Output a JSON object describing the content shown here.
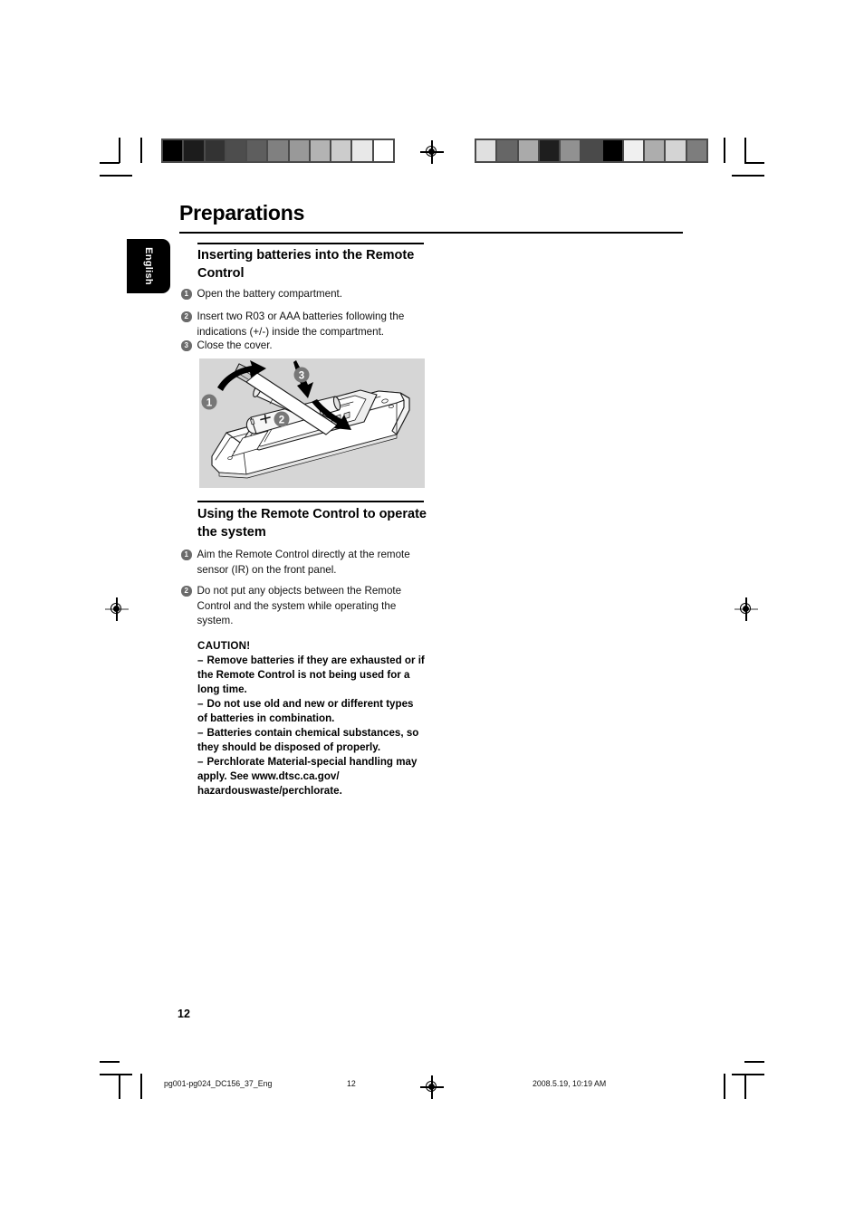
{
  "document": {
    "chapter_title": "Preparations",
    "language_tab": "English",
    "page_number": "12"
  },
  "sections": [
    {
      "heading": "Inserting batteries into the Remote Control",
      "steps": [
        {
          "num": "1",
          "text": "Open the battery compartment."
        },
        {
          "num": "2",
          "text": "Insert two R03 or AAA batteries following the indications (+/-) inside the compartment."
        },
        {
          "num": "3",
          "text": "Close the cover."
        }
      ]
    },
    {
      "heading": "Using the Remote Control to operate the system",
      "steps": [
        {
          "num": "1",
          "text": "Aim the Remote Control directly at the remote sensor (IR) on the front panel."
        },
        {
          "num": "2",
          "text": "Do not put any objects between the Remote Control and the system while operating the system."
        }
      ]
    }
  ],
  "caution": {
    "title": "CAUTION!",
    "dash": "–",
    "items": [
      "Remove batteries if they are exhausted or if the Remote Control is not being used for a long time.",
      "Do not use old and new or different types of batteries in combination.",
      "Batteries contain chemical substances, so they should be disposed of properly.",
      "Perchlorate Material-special handling may apply. See www.dtsc.ca.gov/ hazardouswaste/perchlorate."
    ]
  },
  "figure": {
    "caption": "remote-control-battery-insertion-diagram",
    "callouts": [
      "1",
      "2",
      "3"
    ],
    "battery_polarity": [
      "+",
      "–"
    ],
    "background_color": "#d6d6d6"
  },
  "print_marks": {
    "swatch_strip_left": [
      "#000000",
      "#1c1c1c",
      "#333333",
      "#4d4d4d",
      "#5e5e5e",
      "#808080",
      "#999999",
      "#b3b3b3",
      "#cccccc",
      "#e8e8e8",
      "#ffffff"
    ],
    "swatch_strip_right": [
      "#e0e0e0",
      "#666666",
      "#aaaaaa",
      "#1e1e1e",
      "#919191",
      "#4a4a4a",
      "#000000",
      "#f0f0f0",
      "#adadad",
      "#d4d4d4",
      "#7d7d7d"
    ],
    "registration_mark": "registration-target"
  },
  "footer": {
    "file_name": "pg001-pg024_DC156_37_Eng",
    "page_number": "12",
    "timestamp": "2008.5.19, 10:19 AM"
  }
}
